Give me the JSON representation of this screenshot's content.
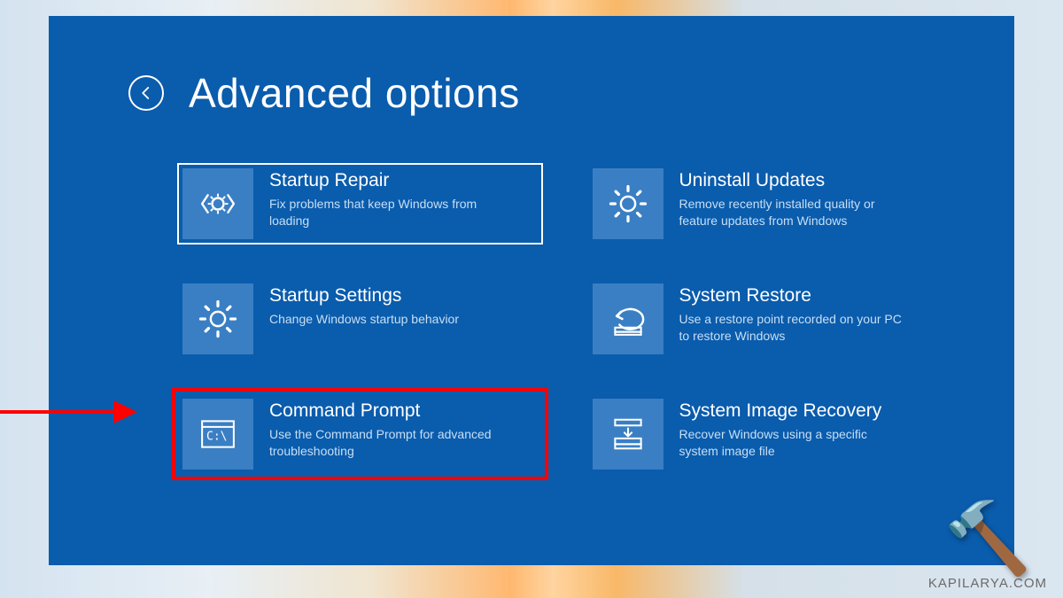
{
  "header": {
    "title": "Advanced options"
  },
  "options": {
    "startup_repair": {
      "title": "Startup Repair",
      "desc": "Fix problems that keep Windows from loading"
    },
    "uninstall_updates": {
      "title": "Uninstall Updates",
      "desc": "Remove recently installed quality or feature updates from Windows"
    },
    "startup_settings": {
      "title": "Startup Settings",
      "desc": "Change Windows startup behavior"
    },
    "system_restore": {
      "title": "System Restore",
      "desc": "Use a restore point recorded on your PC to restore Windows"
    },
    "command_prompt": {
      "title": "Command Prompt",
      "desc": "Use the Command Prompt for advanced troubleshooting"
    },
    "system_image_recovery": {
      "title": "System Image Recovery",
      "desc": "Recover Windows using a specific system image file"
    }
  },
  "watermark": {
    "text": "KAPILARYA.COM"
  }
}
